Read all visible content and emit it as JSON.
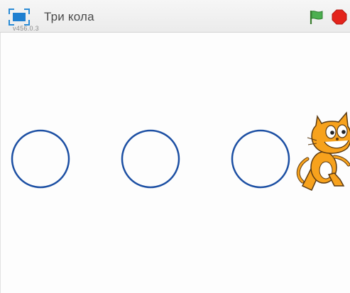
{
  "player": {
    "project_title": "Три кола",
    "version": "v456.0.3"
  },
  "controls": {
    "fullscreen_icon": "fullscreen-icon",
    "green_flag_icon": "green-flag-icon",
    "stop_icon": "stop-icon"
  },
  "colors": {
    "circle_stroke": "#1c4fa3",
    "green_flag": "#4caf50",
    "stop": "#e3231b",
    "cat_orange": "#f7a21d"
  },
  "stage": {
    "sprites": [
      {
        "name": "circle",
        "count": 3
      },
      {
        "name": "cat"
      }
    ]
  }
}
